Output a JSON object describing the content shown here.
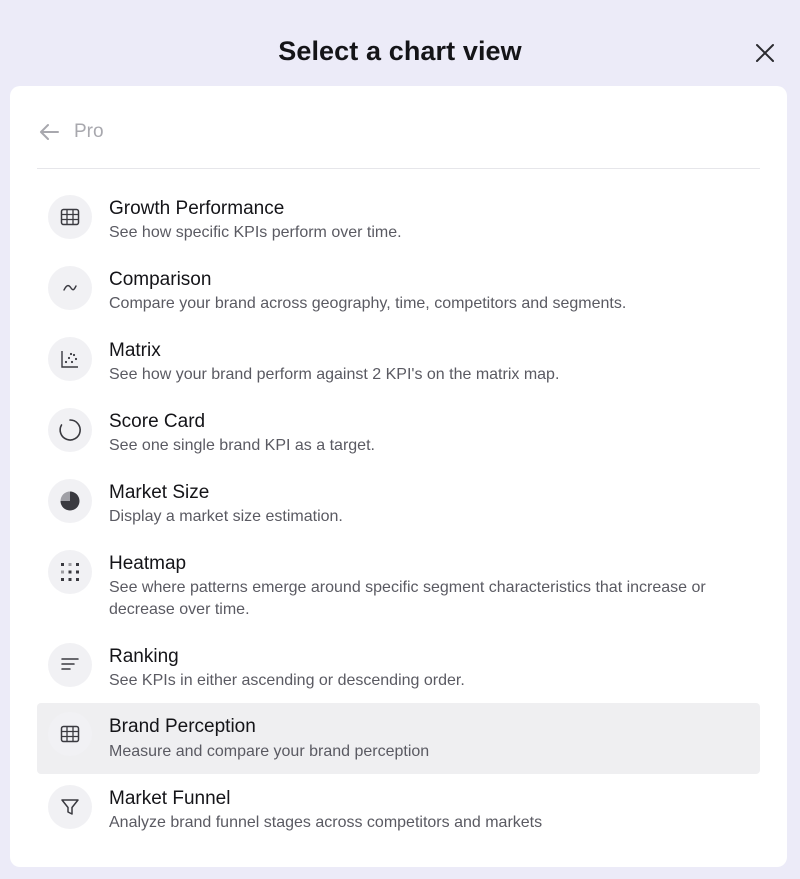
{
  "modal": {
    "title": "Select a chart view",
    "close_icon": "close-icon",
    "back_label": "Pro",
    "back_icon": "arrow-left-icon"
  },
  "items": [
    {
      "title": "Growth Performance",
      "description": "See how specific KPIs perform over time.",
      "icon": "table-icon",
      "selected": false
    },
    {
      "title": "Comparison",
      "description": "Compare your brand across geography, time, competitors and segments.",
      "icon": "line-trend-icon",
      "selected": false
    },
    {
      "title": "Matrix",
      "description": "See how your brand perform against 2 KPI's on the matrix map.",
      "icon": "scatter-icon",
      "selected": false
    },
    {
      "title": "Score Card",
      "description": "See one single brand KPI as a target.",
      "icon": "ring-progress-icon",
      "selected": false
    },
    {
      "title": "Market Size",
      "description": "Display a market size estimation.",
      "icon": "pie-icon",
      "selected": false
    },
    {
      "title": "Heatmap",
      "description": "See where patterns emerge around specific segment characteristics that increase or decrease over time.",
      "icon": "heatmap-icon",
      "selected": false
    },
    {
      "title": "Ranking",
      "description": "See KPIs in either ascending or descending order.",
      "icon": "sort-lines-icon",
      "selected": false
    },
    {
      "title": "Brand Perception",
      "description": "Measure and compare your brand perception",
      "icon": "table-icon",
      "selected": true
    },
    {
      "title": "Market Funnel",
      "description": "Analyze brand funnel stages across competitors and markets",
      "icon": "funnel-icon",
      "selected": false
    }
  ]
}
